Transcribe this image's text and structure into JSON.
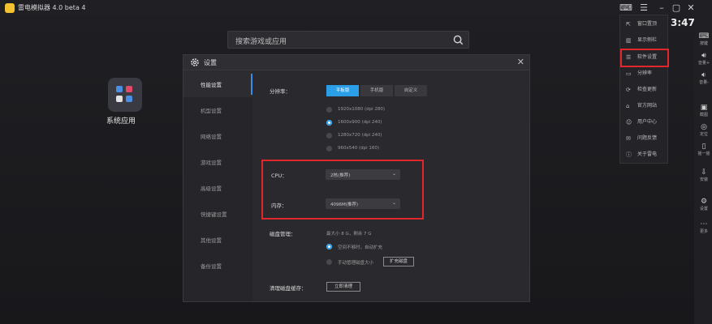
{
  "titlebar": {
    "title": "雷电模拟器 4.0 beta 4"
  },
  "desktop": {
    "search_placeholder": "搜索游戏或应用",
    "system_app_label": "系统应用"
  },
  "clock": "3:47",
  "dropdown": {
    "items": [
      {
        "label": "窗口置顶"
      },
      {
        "label": "显示侧栏"
      },
      {
        "label": "软件设置"
      },
      {
        "label": "分辨率"
      },
      {
        "label": "检查更新"
      },
      {
        "label": "官方网站"
      },
      {
        "label": "用户中心"
      },
      {
        "label": "问题反馈"
      },
      {
        "label": "关于雷电"
      }
    ]
  },
  "right_sidebar": {
    "items": [
      {
        "label": "按键"
      },
      {
        "label": "音量+"
      },
      {
        "label": "音量-"
      },
      {
        "label": "截图"
      },
      {
        "label": "定位"
      },
      {
        "label": "摇一摇"
      },
      {
        "label": "安装"
      },
      {
        "label": "设置"
      },
      {
        "label": "更多"
      }
    ]
  },
  "dialog": {
    "title": "设置",
    "nav": [
      {
        "label": "性能设置",
        "active": true
      },
      {
        "label": "机型设置",
        "active": false
      },
      {
        "label": "网络设置",
        "active": false
      },
      {
        "label": "游戏设置",
        "active": false
      },
      {
        "label": "高级设置",
        "active": false
      },
      {
        "label": "快捷键设置",
        "active": false
      },
      {
        "label": "其他设置",
        "active": false
      },
      {
        "label": "备份设置",
        "active": false
      }
    ],
    "resolution": {
      "label": "分辨率：",
      "tabs": [
        {
          "label": "平板版",
          "selected": true
        },
        {
          "label": "手机版",
          "selected": false
        },
        {
          "label": "自定义",
          "selected": false
        }
      ],
      "options": [
        {
          "label": "1920x1080 (dpi 280)",
          "selected": false
        },
        {
          "label": "1600x900 (dpi 240)",
          "selected": true
        },
        {
          "label": "1280x720 (dpi 240)",
          "selected": false
        },
        {
          "label": "960x540 (dpi 160)",
          "selected": false
        }
      ]
    },
    "cpu": {
      "label": "CPU：",
      "value": "2核(推荐)"
    },
    "memory": {
      "label": "内存：",
      "value": "4096M(推荐)"
    },
    "disk": {
      "label": "磁盘管理：",
      "info": "最大小 8 G，剩余 7 G",
      "options": [
        {
          "label": "空间不够时，自动扩充",
          "selected": true
        },
        {
          "label": "手动管理磁盘大小",
          "selected": false
        }
      ],
      "expand_button": "扩充磁盘"
    },
    "cache": {
      "label": "清理磁盘缓存：",
      "button": "立即清理"
    }
  },
  "colors": {
    "accent": "#2a9ee6",
    "highlight": "#e0282c"
  }
}
